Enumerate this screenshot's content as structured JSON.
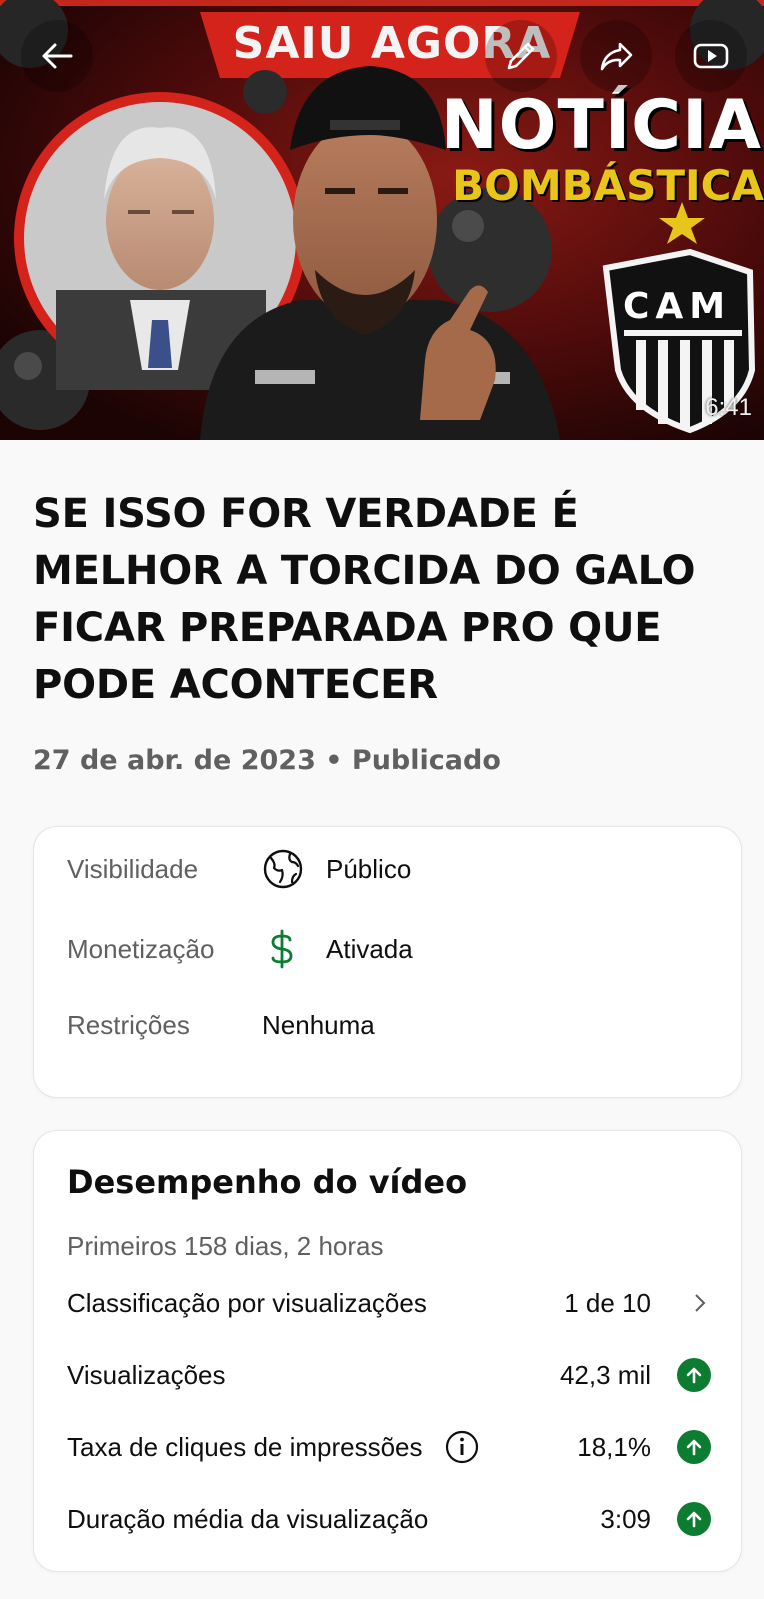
{
  "thumbnail": {
    "banner_text": "SAIU AGORA",
    "headline": "NOTÍCIA",
    "subheadline": "BOMBÁSTICA",
    "crest_text": "CAM",
    "duration": "6:41"
  },
  "video": {
    "title": "SE ISSO FOR VERDADE É MELHOR A TORCIDA DO GALO FICAR PREPARADA PRO QUE PODE ACONTECER",
    "date_status": "27 de abr. de 2023 • Publicado"
  },
  "details": {
    "visibility_label": "Visibilidade",
    "visibility_value": "Público",
    "visibility_icon": "globe-icon",
    "monetization_label": "Monetização",
    "monetization_value": "Ativada",
    "monetization_icon": "dollar-icon",
    "monetization_color": "#0c7c30",
    "restrictions_label": "Restrições",
    "restrictions_value": "Nenhuma"
  },
  "performance": {
    "title": "Desempenho do vídeo",
    "subtitle": "Primeiros 158 dias, 2 horas",
    "metrics": [
      {
        "label": "Classificação por visualizações",
        "value": "1 de 10",
        "end_icon": "chevron-right-icon"
      },
      {
        "label": "Visualizações",
        "value": "42,3 mil",
        "end_icon": "arrow-up-circle-icon"
      },
      {
        "label": "Taxa de cliques de impressões",
        "value": "18,1%",
        "end_icon": "arrow-up-circle-icon",
        "info_icon": "info-icon"
      },
      {
        "label": "Duração média da visualização",
        "value": "3:09",
        "end_icon": "arrow-up-circle-icon"
      }
    ],
    "trend_color": "#0c7c30"
  }
}
